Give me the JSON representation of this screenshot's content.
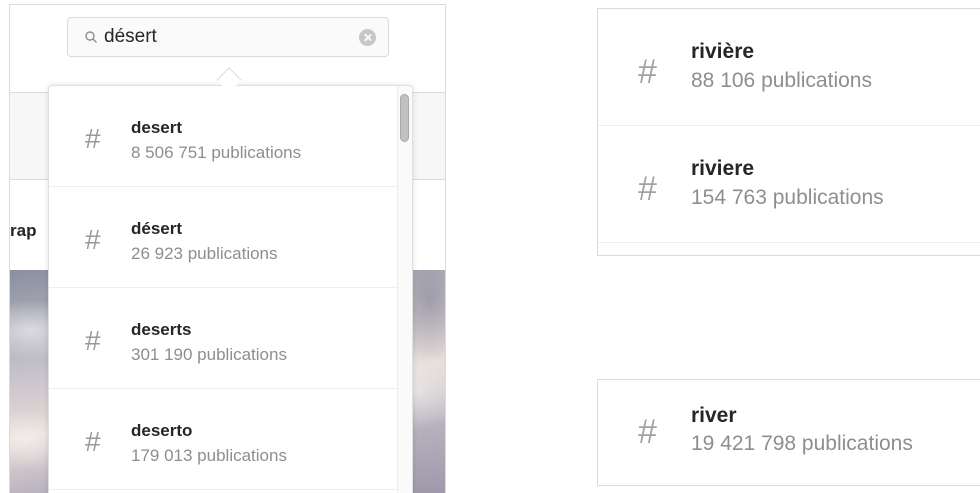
{
  "search": {
    "query": "désert"
  },
  "background": {
    "partial_text": "rap"
  },
  "dropdown_results": [
    {
      "name": "desert",
      "count": "8 506 751 publications"
    },
    {
      "name": "désert",
      "count": "26 923 publications"
    },
    {
      "name": "deserts",
      "count": "301 190 publications"
    },
    {
      "name": "deserto",
      "count": "179 013 publications"
    }
  ],
  "right_cards": {
    "card1": [
      {
        "name": "rivière",
        "count": "88 106 publications"
      },
      {
        "name": "riviere",
        "count": "154 763 publications"
      }
    ],
    "card2": [
      {
        "name": "river",
        "count": "19 421 798 publications"
      }
    ]
  },
  "icons": {
    "hash_glyph": "#"
  },
  "colors": {
    "primary_text": "#262626",
    "secondary_text": "#8e8e8e",
    "border": "#dbdbdb"
  }
}
